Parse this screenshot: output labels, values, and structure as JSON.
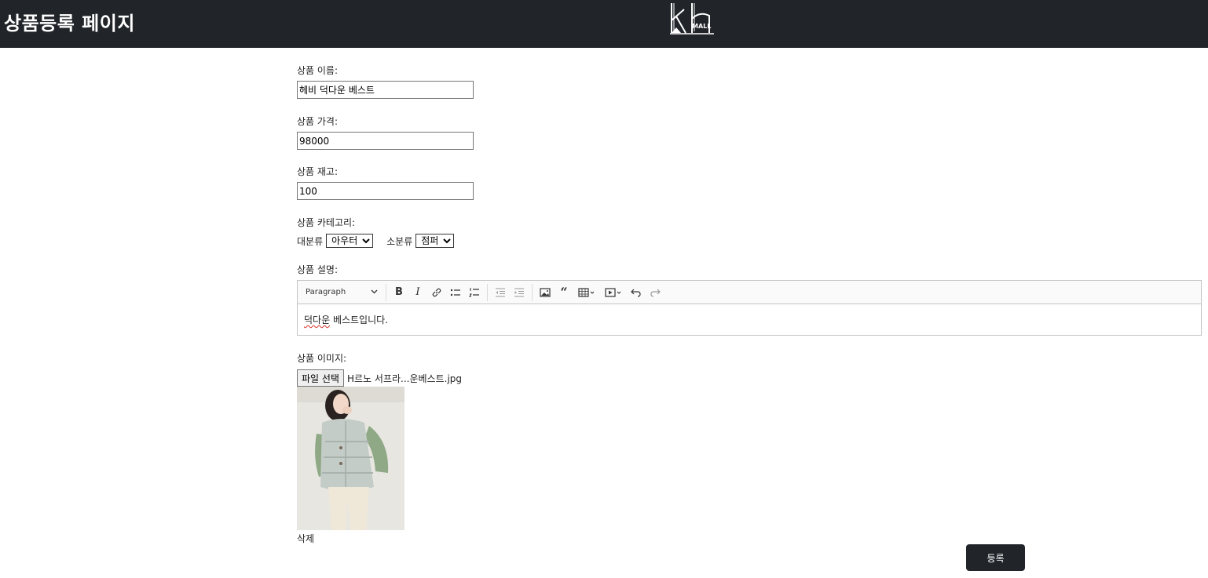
{
  "header": {
    "title": "상품등록 페이지",
    "logo_text": "kh",
    "logo_sub": "MALL"
  },
  "form": {
    "name_label": "상품 이름:",
    "name_value": "헤비 덕다운 베스트",
    "price_label": "상품 가격:",
    "price_value": "98000",
    "stock_label": "상품 재고:",
    "stock_value": "100",
    "category_label": "상품 카테고리:",
    "major_label": "대분류",
    "major_value": "아우터",
    "minor_label": "소분류",
    "minor_value": "점퍼",
    "description_label": "상품 설명:",
    "description_pre": "덕다운",
    "description_post": " 베스트입니다.",
    "image_label": "상품 이미지:",
    "file_button": "파일 선택",
    "file_name": "H르노 서프라...운베스트.jpg",
    "delete_label": "삭제",
    "submit_label": "등록"
  },
  "editor": {
    "heading_value": "Paragraph",
    "tools": [
      "bold-icon",
      "italic-icon",
      "link-icon",
      "bulleted-list-icon",
      "numbered-list-icon",
      "outdent-icon",
      "indent-icon",
      "image-icon",
      "quote-icon",
      "table-icon",
      "media-icon",
      "undo-icon",
      "redo-icon"
    ]
  }
}
